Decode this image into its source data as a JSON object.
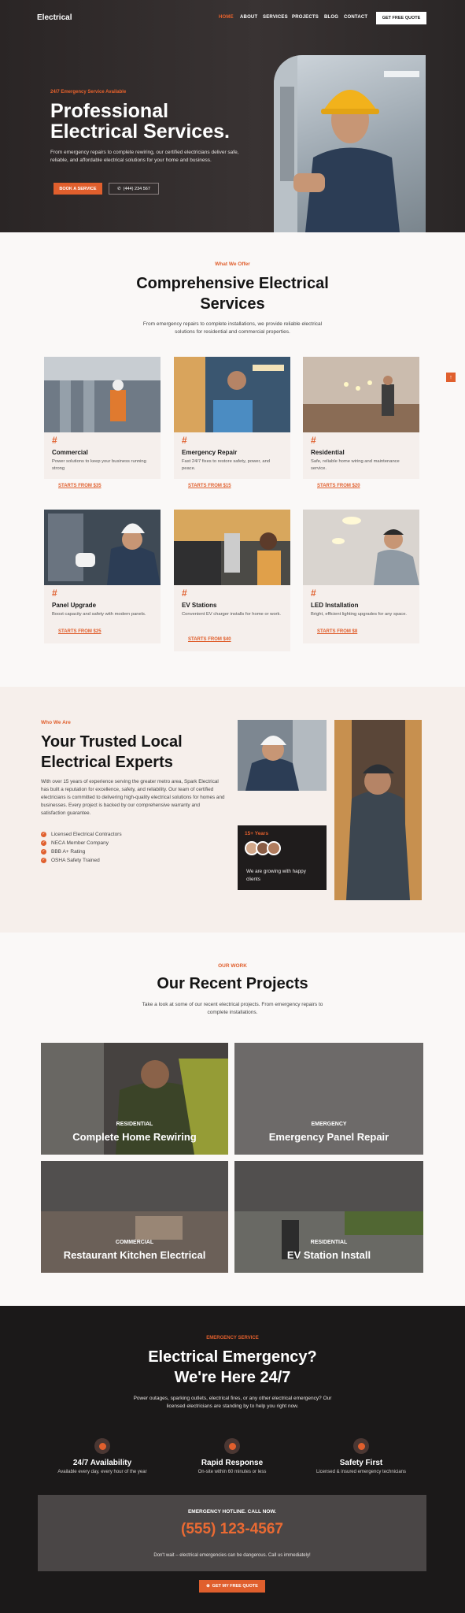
{
  "nav": {
    "logo": "Electrical",
    "links": [
      "HOME",
      "ABOUT",
      "SERVICES",
      "PROJECTS",
      "BLOG",
      "CONTACT"
    ],
    "cta": "GET FREE QUOTE"
  },
  "hero": {
    "eyebrow": "24/7 Emergency Service Available",
    "title": "Professional Electrical Services.",
    "description": "From emergency repairs to complete rewiring, our certified electricians deliver safe, reliable, and affordable electrical solutions for your home and business.",
    "primary_button": "BOOK A SERVICE",
    "phone_button": "(444) 234 567"
  },
  "services": {
    "eyebrow": "What We Offer",
    "title": "Comprehensive Electrical Services",
    "description": "From emergency repairs to complete installations, we provide reliable electrical solutions for residential and commercial properties.",
    "cards": [
      {
        "icon": "#",
        "title": "Commercial",
        "desc": "Power solutions to keep your business running strong",
        "link": "STARTS FROM $35"
      },
      {
        "icon": "#",
        "title": "Emergency Repair",
        "desc": "Fast 24/7 fixes to restore safety, power, and peace.",
        "link": "STARTS FROM $15"
      },
      {
        "icon": "#",
        "title": "Residential",
        "desc": "Safe, reliable home wiring and maintenance service.",
        "link": "STARTS FROM $20"
      },
      {
        "icon": "#",
        "title": "Panel Upgrade",
        "desc": "Boost capacity and safety with modern panels.",
        "link": "STARTS FROM $25"
      },
      {
        "icon": "#",
        "title": "EV Stations",
        "desc": "Convenient EV charger installs for home or work.",
        "link": "STARTS FROM $40"
      },
      {
        "icon": "#",
        "title": "LED Installation",
        "desc": "Bright, efficient lighting upgrades for any space.",
        "link": "STARTS FROM $8"
      }
    ],
    "side_tab": "↑"
  },
  "about": {
    "eyebrow": "Who We Are",
    "title": "Your Trusted Local Electrical Experts",
    "description": "With over 15 years of experience serving the greater metro area, Spark Electrical has built a reputation for excellence, safety, and reliability. Our team of certified electricians is committed to delivering high-quality electrical solutions for homes and businesses. Every project is backed by our comprehensive warranty and satisfaction guarantee.",
    "checks": [
      "Licensed Electrical Contractors",
      "NECA Member Company",
      "BBB A+ Rating",
      "OSHA Safety Trained"
    ],
    "badge_years": "15+ Years",
    "badge_text": "We are growing with happy clients"
  },
  "projects": {
    "eyebrow": "OUR WORK",
    "title": "Our Recent Projects",
    "description": "Take a look at some of our recent electrical projects. From emergency repairs to complete installations.",
    "items": [
      {
        "category": "RESIDENTIAL",
        "title": "Complete Home Rewiring"
      },
      {
        "category": "EMERGENCY",
        "title": "Emergency Panel Repair"
      },
      {
        "category": "COMMERCIAL",
        "title": "Restaurant Kitchen Electrical"
      },
      {
        "category": "RESIDENTIAL",
        "title": "EV Station Install"
      }
    ]
  },
  "emergency": {
    "eyebrow": "EMERGENCY SERVICE",
    "title": "Electrical Emergency? We're Here 24/7",
    "description": "Power outages, sparking outlets, electrical fires, or any other electrical emergency? Our licensed electricians are standing by to help you right now.",
    "features": [
      {
        "title": "24/7 Availability",
        "sub": "Available every day, every hour of the year"
      },
      {
        "title": "Rapid Response",
        "sub": "On-site within 60 minutes or less"
      },
      {
        "title": "Safety First",
        "sub": "Licensed & insured emergency technicians"
      }
    ],
    "hotline_label": "EMERGENCY HOTLINE. CALL NOW.",
    "hotline_number": "(555) 123-4567",
    "hotline_note": "Don't wait – electrical emergencies can be dangerous. Call us immediately!",
    "cta": "GET MY FREE QUOTE"
  },
  "colors": {
    "accent": "#e05f2d",
    "dark": "#1b1919",
    "cream": "#f6efeb"
  }
}
